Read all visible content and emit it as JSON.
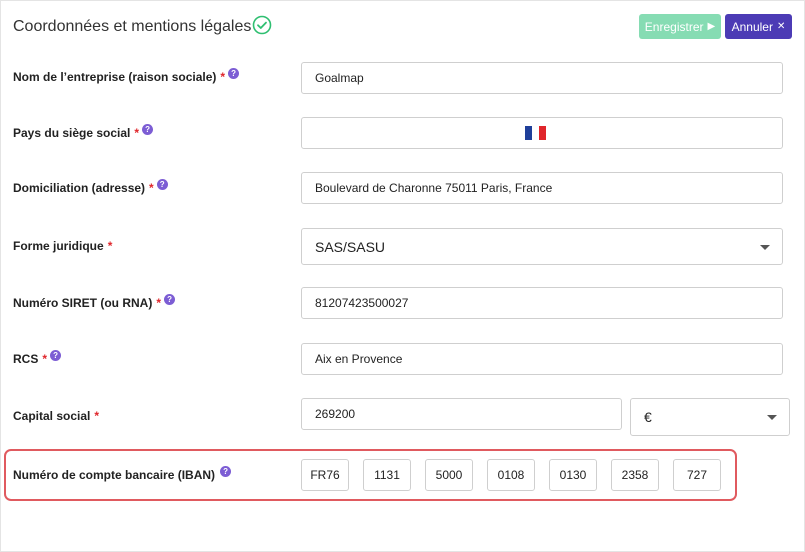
{
  "header": {
    "title": "Coordonnées et mentions légales",
    "save_label": "Enregistrer",
    "cancel_label": "Annuler",
    "accent_save": "#86dcb3",
    "accent_cancel": "#4c3bb5"
  },
  "fields": {
    "company_name": {
      "label": "Nom de l’entreprise (raison sociale)",
      "value": "Goalmap"
    },
    "country": {
      "label": "Pays du siège social",
      "value_icon": "france-flag-icon"
    },
    "address": {
      "label": "Domiciliation (adresse)",
      "value": "Boulevard de Charonne 75011 Paris, France"
    },
    "legal_form": {
      "label": "Forme juridique",
      "value": "SAS/SASU"
    },
    "siret": {
      "label": "Numéro SIRET (ou RNA)",
      "value": "81207423500027"
    },
    "rcs": {
      "label": "RCS",
      "value": "Aix en Provence"
    },
    "capital": {
      "label": "Capital social",
      "value": "269200",
      "currency": "€"
    },
    "iban": {
      "label": "Numéro de compte bancaire (IBAN)",
      "segments": [
        "FR76",
        "1131",
        "5000",
        "0108",
        "0130",
        "2358",
        "727"
      ]
    }
  },
  "required_mark": "*",
  "help_mark": "?"
}
